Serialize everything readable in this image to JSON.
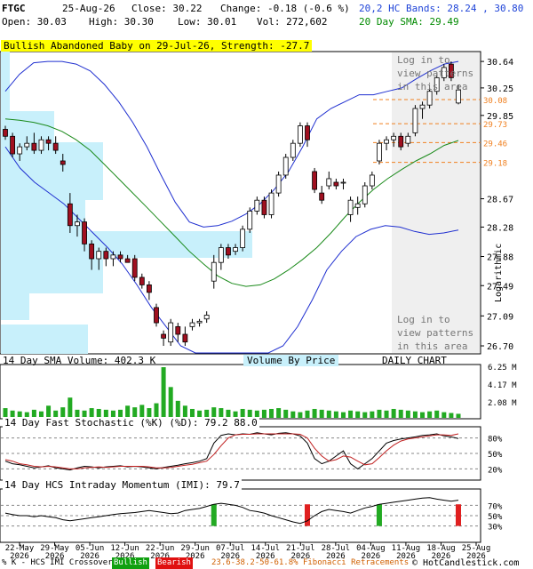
{
  "header": {
    "ticker": "FTGC",
    "date": "25-Aug-26",
    "close_label": "Close: 30.22",
    "change_label": "Change: -0.18 (-0.6 %)",
    "open_label": "Open: 30.03",
    "high_label": "High: 30.30",
    "low_label": "Low: 30.01",
    "vol_label": "Vol: 272,602",
    "bands_label": "20,2 HC Bands: 28.24 , 30.80",
    "sma_label": "20 Day SMA: 29.49"
  },
  "pattern_banner": "Bullish Abandoned Baby on 29-Jul-26, Strength: -27.7",
  "login_text_1": [
    "Log in to",
    "view patterns",
    "in this area"
  ],
  "login_text_2": [
    "Log in to",
    "view patterns",
    "in this area"
  ],
  "panels": {
    "volume_label": "14 Day SMA Volume: 402.3 K",
    "vbp_label": "Volume By Price",
    "daily_chart_label": "DAILY CHART",
    "stoch_label": "14 Day Fast Stochastic (%K) (%D): 79.2  88.0",
    "imi_label": "14 Day HCS Intraday Momentum (IMI): 79.7",
    "logarithmic_label": "Logarithmic"
  },
  "footer": {
    "legend_prefix": "% K - HCS IMI Crossover,",
    "bullish": "Bullish",
    "bearish": "Bearish",
    "fib": "23.6-38.2-50-61.8% Fibonacci Retracements",
    "copyright": "© HotCandlestick.com"
  },
  "colors": {
    "band": "#1f2fd0",
    "sma": "#1a8a1a",
    "up": "#ffffff",
    "down": "#a01020",
    "vbp": "#c8f0fb",
    "volume": "#22aa22",
    "fib": "#f08020",
    "signal_bull": "#22aa22",
    "signal_bear": "#e02020"
  },
  "chart_data": {
    "type": "candlestick",
    "scale": "logarithmic",
    "price_ticks": [
      "30.64",
      "30.25",
      "29.85",
      "28.67",
      "28.28",
      "27.88",
      "27.49",
      "27.09",
      "26.70"
    ],
    "fib_levels": [
      "30.08",
      "29.73",
      "29.46",
      "29.18"
    ],
    "x_labels": [
      "22-May\n2026",
      "29-May\n2026",
      "05-Jun\n2026",
      "12-Jun\n2026",
      "22-Jun\n2026",
      "29-Jun\n2026",
      "07-Jul\n2026",
      "14-Jul\n2026",
      "21-Jul\n2026",
      "28-Jul\n2026",
      "04-Aug\n2026",
      "11-Aug\n2026",
      "18-Aug\n2026",
      "25-Aug\n2026"
    ],
    "volume_ticks": [
      "6.25 M",
      "4.17 M",
      "2.08 M"
    ],
    "stoch_ticks": [
      "80%",
      "50%",
      "20%"
    ],
    "imi_ticks": [
      "70%",
      "50%",
      "30%"
    ],
    "ohlc": [
      [
        29.65,
        29.7,
        29.5,
        29.55
      ],
      [
        29.55,
        29.6,
        29.25,
        29.3
      ],
      [
        29.3,
        29.45,
        29.2,
        29.4
      ],
      [
        29.4,
        29.55,
        29.35,
        29.45
      ],
      [
        29.45,
        29.6,
        29.3,
        29.35
      ],
      [
        29.35,
        29.55,
        29.3,
        29.5
      ],
      [
        29.5,
        29.55,
        29.35,
        29.45
      ],
      [
        29.45,
        29.55,
        29.3,
        29.35
      ],
      [
        29.2,
        29.3,
        29.05,
        29.15
      ],
      [
        28.6,
        28.75,
        28.2,
        28.3
      ],
      [
        28.3,
        28.45,
        28.15,
        28.35
      ],
      [
        28.35,
        28.4,
        27.95,
        28.05
      ],
      [
        28.05,
        28.1,
        27.7,
        27.85
      ],
      [
        27.85,
        28.0,
        27.7,
        27.95
      ],
      [
        27.95,
        28.0,
        27.75,
        27.85
      ],
      [
        27.85,
        27.95,
        27.75,
        27.9
      ],
      [
        27.9,
        27.95,
        27.8,
        27.85
      ],
      [
        27.85,
        27.9,
        27.8,
        27.8
      ],
      [
        27.85,
        27.9,
        27.55,
        27.6
      ],
      [
        27.6,
        27.65,
        27.45,
        27.5
      ],
      [
        27.5,
        27.55,
        27.3,
        27.4
      ],
      [
        27.2,
        27.25,
        26.95,
        27.0
      ],
      [
        26.85,
        26.9,
        26.7,
        26.8
      ],
      [
        26.75,
        27.05,
        26.7,
        27.0
      ],
      [
        26.95,
        27.0,
        26.75,
        26.85
      ],
      [
        26.85,
        26.95,
        26.7,
        26.75
      ],
      [
        26.95,
        27.05,
        26.9,
        27.0
      ],
      [
        27.0,
        27.05,
        26.95,
        27.02
      ],
      [
        27.05,
        27.15,
        27.0,
        27.1
      ],
      [
        27.55,
        27.9,
        27.45,
        27.8
      ],
      [
        27.8,
        28.05,
        27.7,
        28.0
      ],
      [
        28.0,
        28.05,
        27.85,
        27.9
      ],
      [
        27.95,
        28.05,
        27.9,
        28.0
      ],
      [
        28.0,
        28.3,
        27.95,
        28.25
      ],
      [
        28.25,
        28.55,
        28.2,
        28.5
      ],
      [
        28.5,
        28.7,
        28.45,
        28.65
      ],
      [
        28.65,
        28.7,
        28.4,
        28.45
      ],
      [
        28.45,
        28.8,
        28.4,
        28.75
      ],
      [
        28.75,
        29.05,
        28.7,
        29.0
      ],
      [
        29.0,
        29.3,
        28.95,
        29.25
      ],
      [
        29.25,
        29.5,
        29.2,
        29.45
      ],
      [
        29.45,
        29.75,
        29.4,
        29.7
      ],
      [
        29.7,
        29.75,
        29.4,
        29.5
      ],
      [
        29.05,
        29.1,
        28.75,
        28.8
      ],
      [
        28.75,
        28.85,
        28.6,
        28.65
      ],
      [
        28.85,
        29.05,
        28.8,
        28.95
      ],
      [
        28.9,
        28.95,
        28.8,
        28.85
      ],
      [
        28.9,
        28.95,
        28.8,
        28.9
      ],
      [
        28.45,
        28.7,
        28.35,
        28.65
      ],
      [
        28.55,
        28.7,
        28.45,
        28.6
      ],
      [
        28.6,
        28.9,
        28.55,
        28.85
      ],
      [
        28.85,
        29.05,
        28.8,
        29.0
      ],
      [
        29.2,
        29.5,
        29.15,
        29.45
      ],
      [
        29.45,
        29.55,
        29.35,
        29.5
      ],
      [
        29.5,
        29.6,
        29.4,
        29.55
      ],
      [
        29.55,
        29.6,
        29.35,
        29.4
      ],
      [
        29.45,
        29.6,
        29.4,
        29.55
      ],
      [
        29.6,
        30.0,
        29.55,
        29.95
      ],
      [
        29.95,
        30.05,
        29.8,
        30.0
      ],
      [
        30.0,
        30.25,
        29.95,
        30.2
      ],
      [
        30.2,
        30.45,
        30.15,
        30.4
      ],
      [
        30.4,
        30.6,
        30.35,
        30.55
      ],
      [
        30.6,
        30.64,
        30.35,
        30.4
      ],
      [
        30.03,
        30.3,
        30.01,
        30.22
      ]
    ],
    "upper_band": [
      30.2,
      30.45,
      30.62,
      30.64,
      30.64,
      30.6,
      30.5,
      30.3,
      30.05,
      29.75,
      29.4,
      29.0,
      28.62,
      28.35,
      28.28,
      28.3,
      28.36,
      28.46,
      28.6,
      28.8,
      29.05,
      29.4,
      29.8,
      29.95,
      30.05,
      30.15,
      30.15,
      30.2,
      30.25,
      30.38,
      30.5,
      30.6,
      30.64
    ],
    "sma20": [
      29.8,
      29.78,
      29.75,
      29.7,
      29.62,
      29.5,
      29.35,
      29.15,
      28.95,
      28.75,
      28.55,
      28.35,
      28.15,
      27.95,
      27.78,
      27.62,
      27.52,
      27.48,
      27.5,
      27.58,
      27.7,
      27.84,
      28.0,
      28.2,
      28.42,
      28.62,
      28.8,
      28.95,
      29.08,
      29.2,
      29.3,
      29.42,
      29.49
    ],
    "lower_band": [
      29.4,
      29.1,
      28.9,
      28.75,
      28.6,
      28.4,
      28.2,
      28.0,
      27.78,
      27.5,
      27.2,
      26.95,
      26.7,
      26.55,
      26.45,
      26.4,
      26.4,
      26.45,
      26.55,
      26.7,
      26.95,
      27.3,
      27.7,
      27.95,
      28.15,
      28.25,
      28.3,
      28.28,
      28.22,
      28.18,
      28.2,
      28.24
    ],
    "volume": [
      1.2,
      0.9,
      0.8,
      0.7,
      1.0,
      0.8,
      1.5,
      0.9,
      1.3,
      2.5,
      1.0,
      0.9,
      1.2,
      1.1,
      1.0,
      0.9,
      1.0,
      1.5,
      1.3,
      1.6,
      1.2,
      1.8,
      6.25,
      3.8,
      2.1,
      1.5,
      1.1,
      0.9,
      1.0,
      1.3,
      1.2,
      1.0,
      0.8,
      1.1,
      1.0,
      0.9,
      1.0,
      1.1,
      1.2,
      1.0,
      0.8,
      0.7,
      0.9,
      1.1,
      1.0,
      0.9,
      0.8,
      0.7,
      0.9,
      0.8,
      0.7,
      0.8,
      1.0,
      0.9,
      1.1,
      1.0,
      0.9,
      0.8,
      0.7,
      0.8,
      0.9,
      0.7,
      0.6,
      0.5
    ],
    "stoch_k": [
      35,
      30,
      28,
      25,
      22,
      24,
      26,
      22,
      20,
      18,
      22,
      25,
      24,
      22,
      24,
      25,
      26,
      24,
      25,
      24,
      22,
      20,
      23,
      25,
      27,
      30,
      32,
      35,
      40,
      70,
      85,
      88,
      86,
      88,
      87,
      90,
      88,
      86,
      89,
      90,
      88,
      84,
      70,
      40,
      30,
      35,
      45,
      55,
      30,
      20,
      30,
      40,
      55,
      70,
      75,
      78,
      80,
      82,
      85,
      86,
      88,
      84,
      82,
      79
    ],
    "stoch_d": [
      38,
      35,
      30,
      28,
      25,
      24,
      25,
      24,
      22,
      20,
      20,
      22,
      23,
      24,
      23,
      24,
      25,
      25,
      25,
      25,
      24,
      22,
      22,
      23,
      25,
      27,
      29,
      32,
      35,
      48,
      65,
      80,
      86,
      87,
      87,
      88,
      88,
      88,
      88,
      88,
      88,
      87,
      80,
      60,
      45,
      35,
      38,
      45,
      43,
      35,
      28,
      30,
      42,
      55,
      66,
      74,
      78,
      80,
      82,
      84,
      86,
      86,
      85,
      88
    ],
    "imi": [
      55,
      52,
      50,
      50,
      48,
      50,
      48,
      46,
      42,
      40,
      42,
      44,
      46,
      48,
      50,
      52,
      54,
      55,
      56,
      58,
      60,
      58,
      56,
      54,
      55,
      60,
      62,
      64,
      68,
      72,
      74,
      72,
      70,
      66,
      60,
      58,
      55,
      50,
      46,
      42,
      38,
      35,
      40,
      50,
      58,
      62,
      60,
      58,
      55,
      60,
      65,
      68,
      72,
      74,
      76,
      78,
      80,
      82,
      84,
      85,
      82,
      80,
      78,
      80
    ],
    "signals": [
      {
        "i": 29,
        "type": "bull"
      },
      {
        "i": 42,
        "type": "bear"
      },
      {
        "i": 52,
        "type": "bull"
      },
      {
        "i": 63,
        "type": "bear"
      }
    ]
  }
}
